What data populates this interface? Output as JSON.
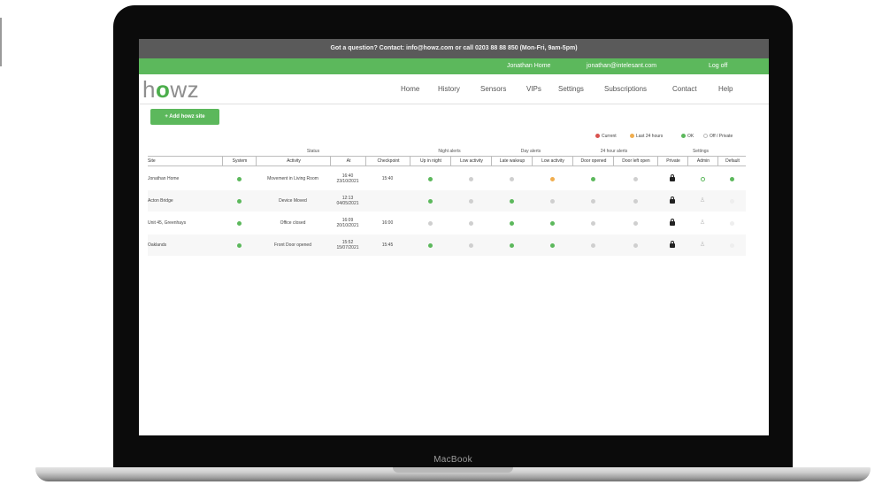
{
  "device": {
    "brand": "MacBook"
  },
  "topbar": {
    "text": "Got a question? Contact: info@howz.com or call 0203 88 88 850 (Mon-Fri, 9am-5pm)"
  },
  "userbar": {
    "home_link": "Jonathan Home",
    "email_link": "jonathan@intelesant.com",
    "logoff_link": "Log off"
  },
  "logo": {
    "text_before": "h",
    "text_o": "o",
    "text_after": "wz"
  },
  "nav": {
    "items": [
      "Home",
      "History",
      "Sensors",
      "VIPs",
      "Settings",
      "Subscriptions",
      "Contact",
      "Help"
    ]
  },
  "add_button": {
    "label": "+ Add howz site"
  },
  "legend": {
    "current": "Current",
    "last24": "Last 24 hours",
    "ok": "OK",
    "off": "Off / Private"
  },
  "groups": {
    "status": "Status",
    "night": "Night alerts",
    "day": "Day alerts",
    "h24": "24 hour alerts",
    "settings": "Settings"
  },
  "columns": [
    "Site",
    "System",
    "Activity",
    "At",
    "Checkpoint",
    "Up in night",
    "Low activity",
    "Late wakeup",
    "Low activity",
    "Door opened",
    "Door left open",
    "Private",
    "Admin",
    "Default"
  ],
  "rows": [
    {
      "site": "Jonathan Home",
      "activity": "Movement in Living Room",
      "time": "16:40",
      "date": "23/10/2021",
      "checkpoint": "15:40",
      "status": [
        "green",
        "grey",
        "grey",
        "orange",
        "green",
        "grey",
        "lock",
        "green-ring",
        "green"
      ]
    },
    {
      "site": "Acton Bridge",
      "activity": "Device Moved",
      "time": "12:13",
      "date": "04/05/2021",
      "checkpoint": "",
      "status": [
        "green",
        "grey",
        "green",
        "grey",
        "grey",
        "grey",
        "lock",
        "person",
        "light"
      ]
    },
    {
      "site": "Unit 45, Greenhays",
      "activity": "Office closed",
      "time": "16:09",
      "date": "20/10/2021",
      "checkpoint": "16:00",
      "status": [
        "grey",
        "grey",
        "green",
        "green",
        "grey",
        "grey",
        "lock",
        "person",
        "light"
      ]
    },
    {
      "site": "Oaklands",
      "activity": "Front Door opened",
      "time": "15:52",
      "date": "15/07/2021",
      "checkpoint": "15:45",
      "status": [
        "green",
        "grey",
        "green",
        "green",
        "grey",
        "grey",
        "lock",
        "person",
        "light"
      ]
    }
  ],
  "colors": {
    "green": "#5cb85c",
    "orange": "#f0ad4e",
    "red": "#d9534f",
    "grey": "#cfcfcf",
    "topbar": "#5a5a5a"
  }
}
